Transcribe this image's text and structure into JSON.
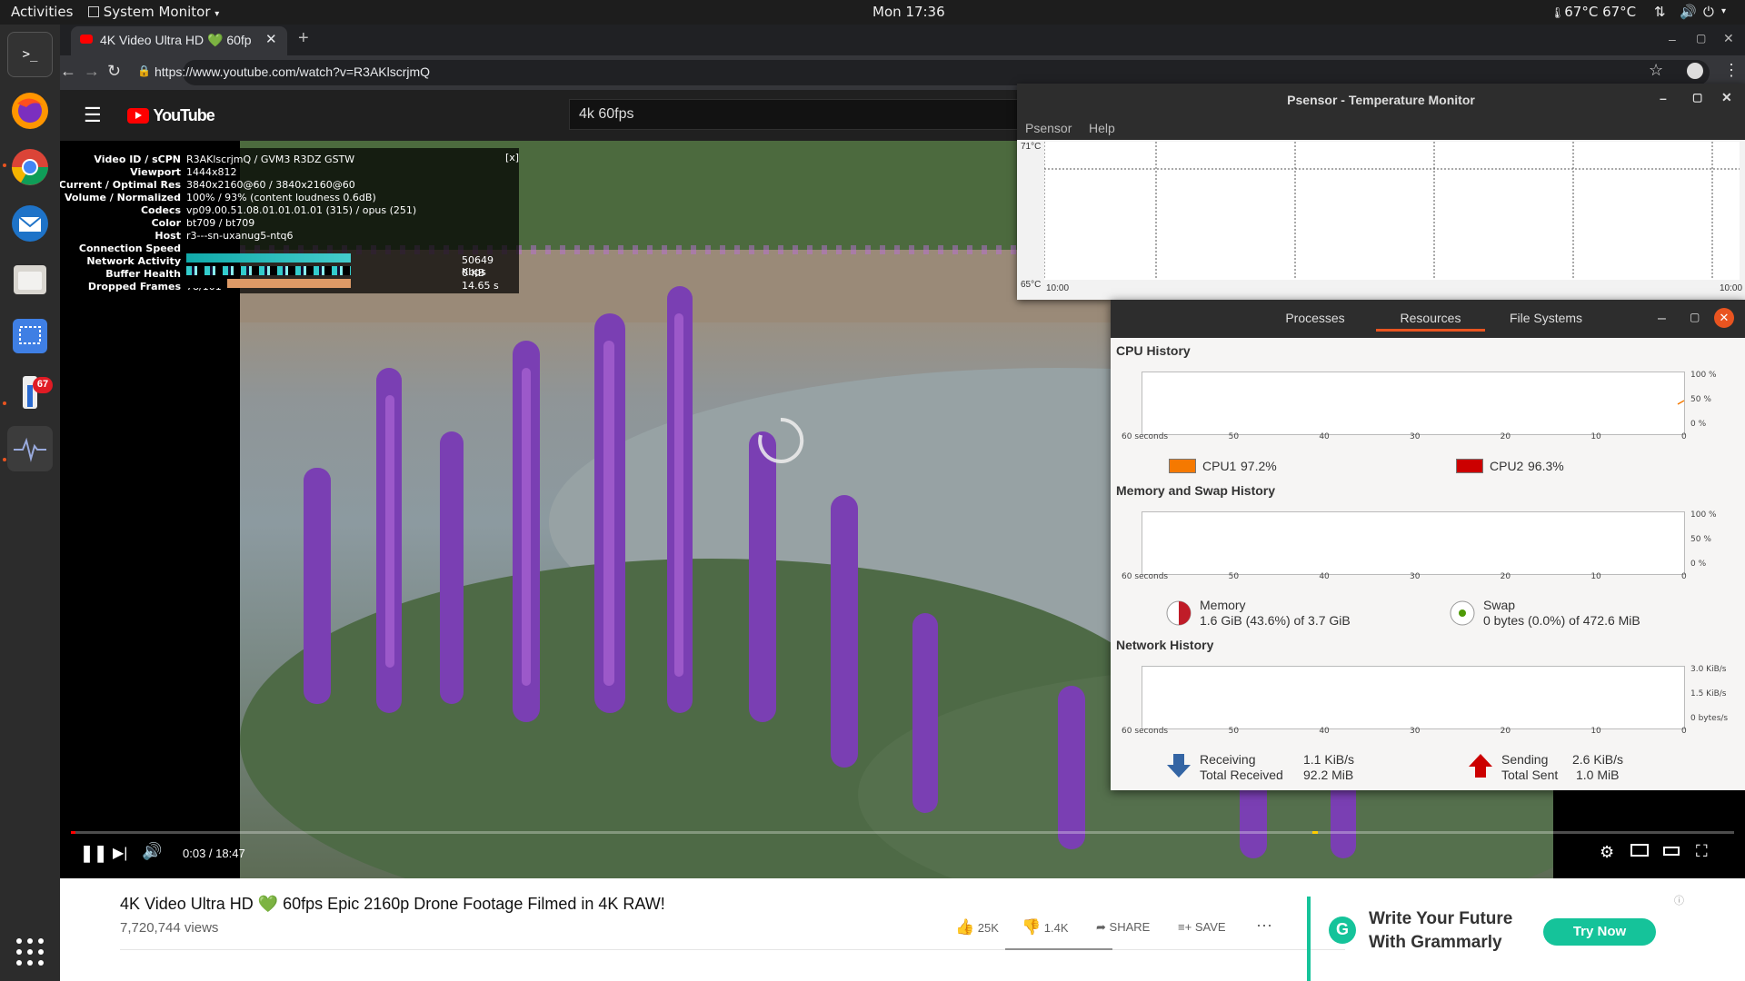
{
  "topbar": {
    "activities": "Activities",
    "app_menu": "System Monitor",
    "clock": "Mon 17:36",
    "temperature": "67°C 67°C"
  },
  "dock": {
    "notification_badge": "67"
  },
  "browser": {
    "tab_title": "4K Video Ultra HD 💚 60fp",
    "url": "https://www.youtube.com/watch?v=R3AKlscrjmQ"
  },
  "youtube": {
    "logo": "YouTube",
    "search_value": "4k 60fps",
    "stats": {
      "close": "[x]",
      "rows": [
        {
          "k": "Video ID / sCPN",
          "v": "R3AKlscrjmQ / GVM3 R3DZ GSTW"
        },
        {
          "k": "Viewport",
          "v": "1444x812"
        },
        {
          "k": "Current / Optimal Res",
          "v": "3840x2160@60 / 3840x2160@60"
        },
        {
          "k": "Volume / Normalized",
          "v": "100% / 93% (content loudness 0.6dB)"
        },
        {
          "k": "Codecs",
          "v": "vp09.00.51.08.01.01.01.01 (315) / opus (251)"
        },
        {
          "k": "Color",
          "v": "bt709 / bt709"
        },
        {
          "k": "Host",
          "v": "r3---sn-uxanug5-ntq6"
        },
        {
          "k": "Connection Speed",
          "v": ""
        },
        {
          "k": "Network Activity",
          "v": ""
        },
        {
          "k": "Buffer Health",
          "v": ""
        },
        {
          "k": "Dropped Frames",
          "v": "78/101"
        }
      ],
      "connection_speed": "50649 Kbps",
      "network_activity": "0 KB",
      "buffer_health": "14.65 s"
    },
    "time": "0:03 / 18:47",
    "progress": 0.003,
    "video_title": "4K Video Ultra HD 💚 60fps Epic 2160p Drone Footage Filmed in 4K RAW!",
    "views": "7,720,744 views",
    "likes": "25K",
    "dislikes": "1.4K",
    "share": "SHARE",
    "save": "SAVE",
    "ad_title_1": "Write Your Future",
    "ad_title_2": "With Grammarly",
    "ad_button": "Try Now"
  },
  "psensor": {
    "title": "Psensor - Temperature Monitor",
    "menu": [
      "Psensor",
      "Help"
    ],
    "y_max": "71°C",
    "y_min": "65°C",
    "x_start": "10:00",
    "x_end": "10:00"
  },
  "sysmon": {
    "tabs": [
      "Processes",
      "Resources",
      "File Systems"
    ],
    "active_tab": "Resources",
    "cpu_title": "CPU History",
    "mem_title": "Memory and Swap History",
    "net_title": "Network History",
    "x_ticks": [
      "60 seconds",
      "50",
      "40",
      "30",
      "20",
      "10",
      "0"
    ],
    "pct_ticks": [
      "100 %",
      "50 %",
      "0 %"
    ],
    "net_ticks": [
      "3.0 KiB/s",
      "1.5 KiB/s",
      "0 bytes/s"
    ],
    "cpu1_label": "CPU1",
    "cpu1_value": "97.2%",
    "cpu2_label": "CPU2",
    "cpu2_value": "96.3%",
    "memory_label": "Memory",
    "memory_value": "1.6 GiB (43.6%) of 3.7 GiB",
    "swap_label": "Swap",
    "swap_value": "0 bytes (0.0%) of 472.6 MiB",
    "receiving_label": "Receiving",
    "receiving_value": "1.1 KiB/s",
    "total_received_label": "Total Received",
    "total_received_value": "92.2 MiB",
    "sending_label": "Sending",
    "sending_value": "2.6 KiB/s",
    "total_sent_label": "Total Sent",
    "total_sent_value": "1.0 MiB",
    "colors": {
      "cpu1": "#f57900",
      "cpu2": "#cc0000",
      "memory": "#c01c28",
      "swap": "#4e9a06",
      "receive": "#3465a4",
      "send": "#cc0000"
    }
  }
}
